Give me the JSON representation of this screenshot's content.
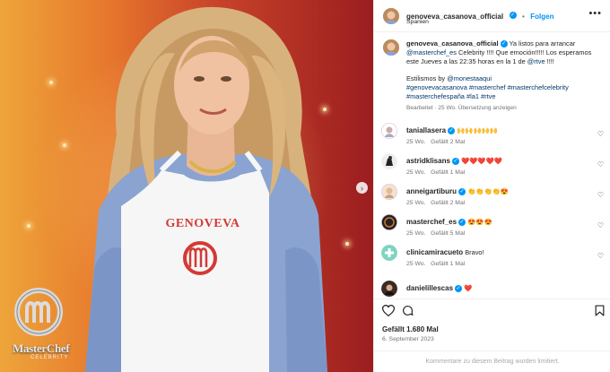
{
  "header": {
    "username": "genoveva_casanova_official",
    "follow_label": "Folgen",
    "location": "Spanien",
    "separator": "•"
  },
  "caption": {
    "username": "genoveva_casanova_official",
    "text_1": " Ya listos para arrancar ",
    "mention_1": "@masterchef_es",
    "text_2": " Celebrity !!!! Que emoción!!!!! Los esperamos este Jueves a las 22:35 horas en la 1 de ",
    "mention_2": "@rtve",
    "text_3": " !!!!",
    "styling_prefix": "Estilismos by ",
    "mention_3": "@monestaaqui",
    "hashtags": "#genovevacasanova #masterchef #masterchefcelebrity #masterchefespaña #la1 #rtve",
    "meta": "Bearbeitet · 25 Wo.   Übersetzung anzeigen"
  },
  "media": {
    "apron_text": "GENOVEVA",
    "logo_text": "MasterChef",
    "logo_sub": "CELEBRITY",
    "next_arrow": "›"
  },
  "comments": [
    {
      "user": "taniallasera",
      "verified": true,
      "text": "🙌🙌🙌🙌🙌",
      "age": "25 Wo.",
      "likes": "Gefällt 2 Mal"
    },
    {
      "user": "astridklisans",
      "verified": true,
      "text": "❤️❤️❤️❤️❤️",
      "age": "25 Wo.",
      "likes": "Gefällt 1 Mal"
    },
    {
      "user": "anneigartiburu",
      "verified": true,
      "text": "👏👏👏👏😍",
      "age": "25 Wo.",
      "likes": "Gefällt 2 Mal"
    },
    {
      "user": "masterchef_es",
      "verified": true,
      "text": "😍😍😍",
      "age": "25 Wo.",
      "likes": "Gefällt 5 Mal"
    },
    {
      "user": "clinicamiracueto",
      "verified": false,
      "text": "Bravo!",
      "age": "25 Wo.",
      "likes": "Gefällt 1 Mal"
    },
    {
      "user": "danielillescas",
      "verified": true,
      "text": "❤️",
      "age": "",
      "likes": ""
    }
  ],
  "actions": {
    "likes": "Gefällt 1.680 Mal",
    "date": "6. September 2023"
  },
  "footer": {
    "text": "Kommentare zu diesem Beitrag wurden limitiert."
  },
  "colors": {
    "accent": "#0095f6",
    "link": "#00376b",
    "muted": "#737373"
  },
  "icons": [
    "verified-icon",
    "more-icon",
    "heart-icon",
    "comment-icon",
    "bookmark-icon",
    "chevron-right-icon"
  ]
}
